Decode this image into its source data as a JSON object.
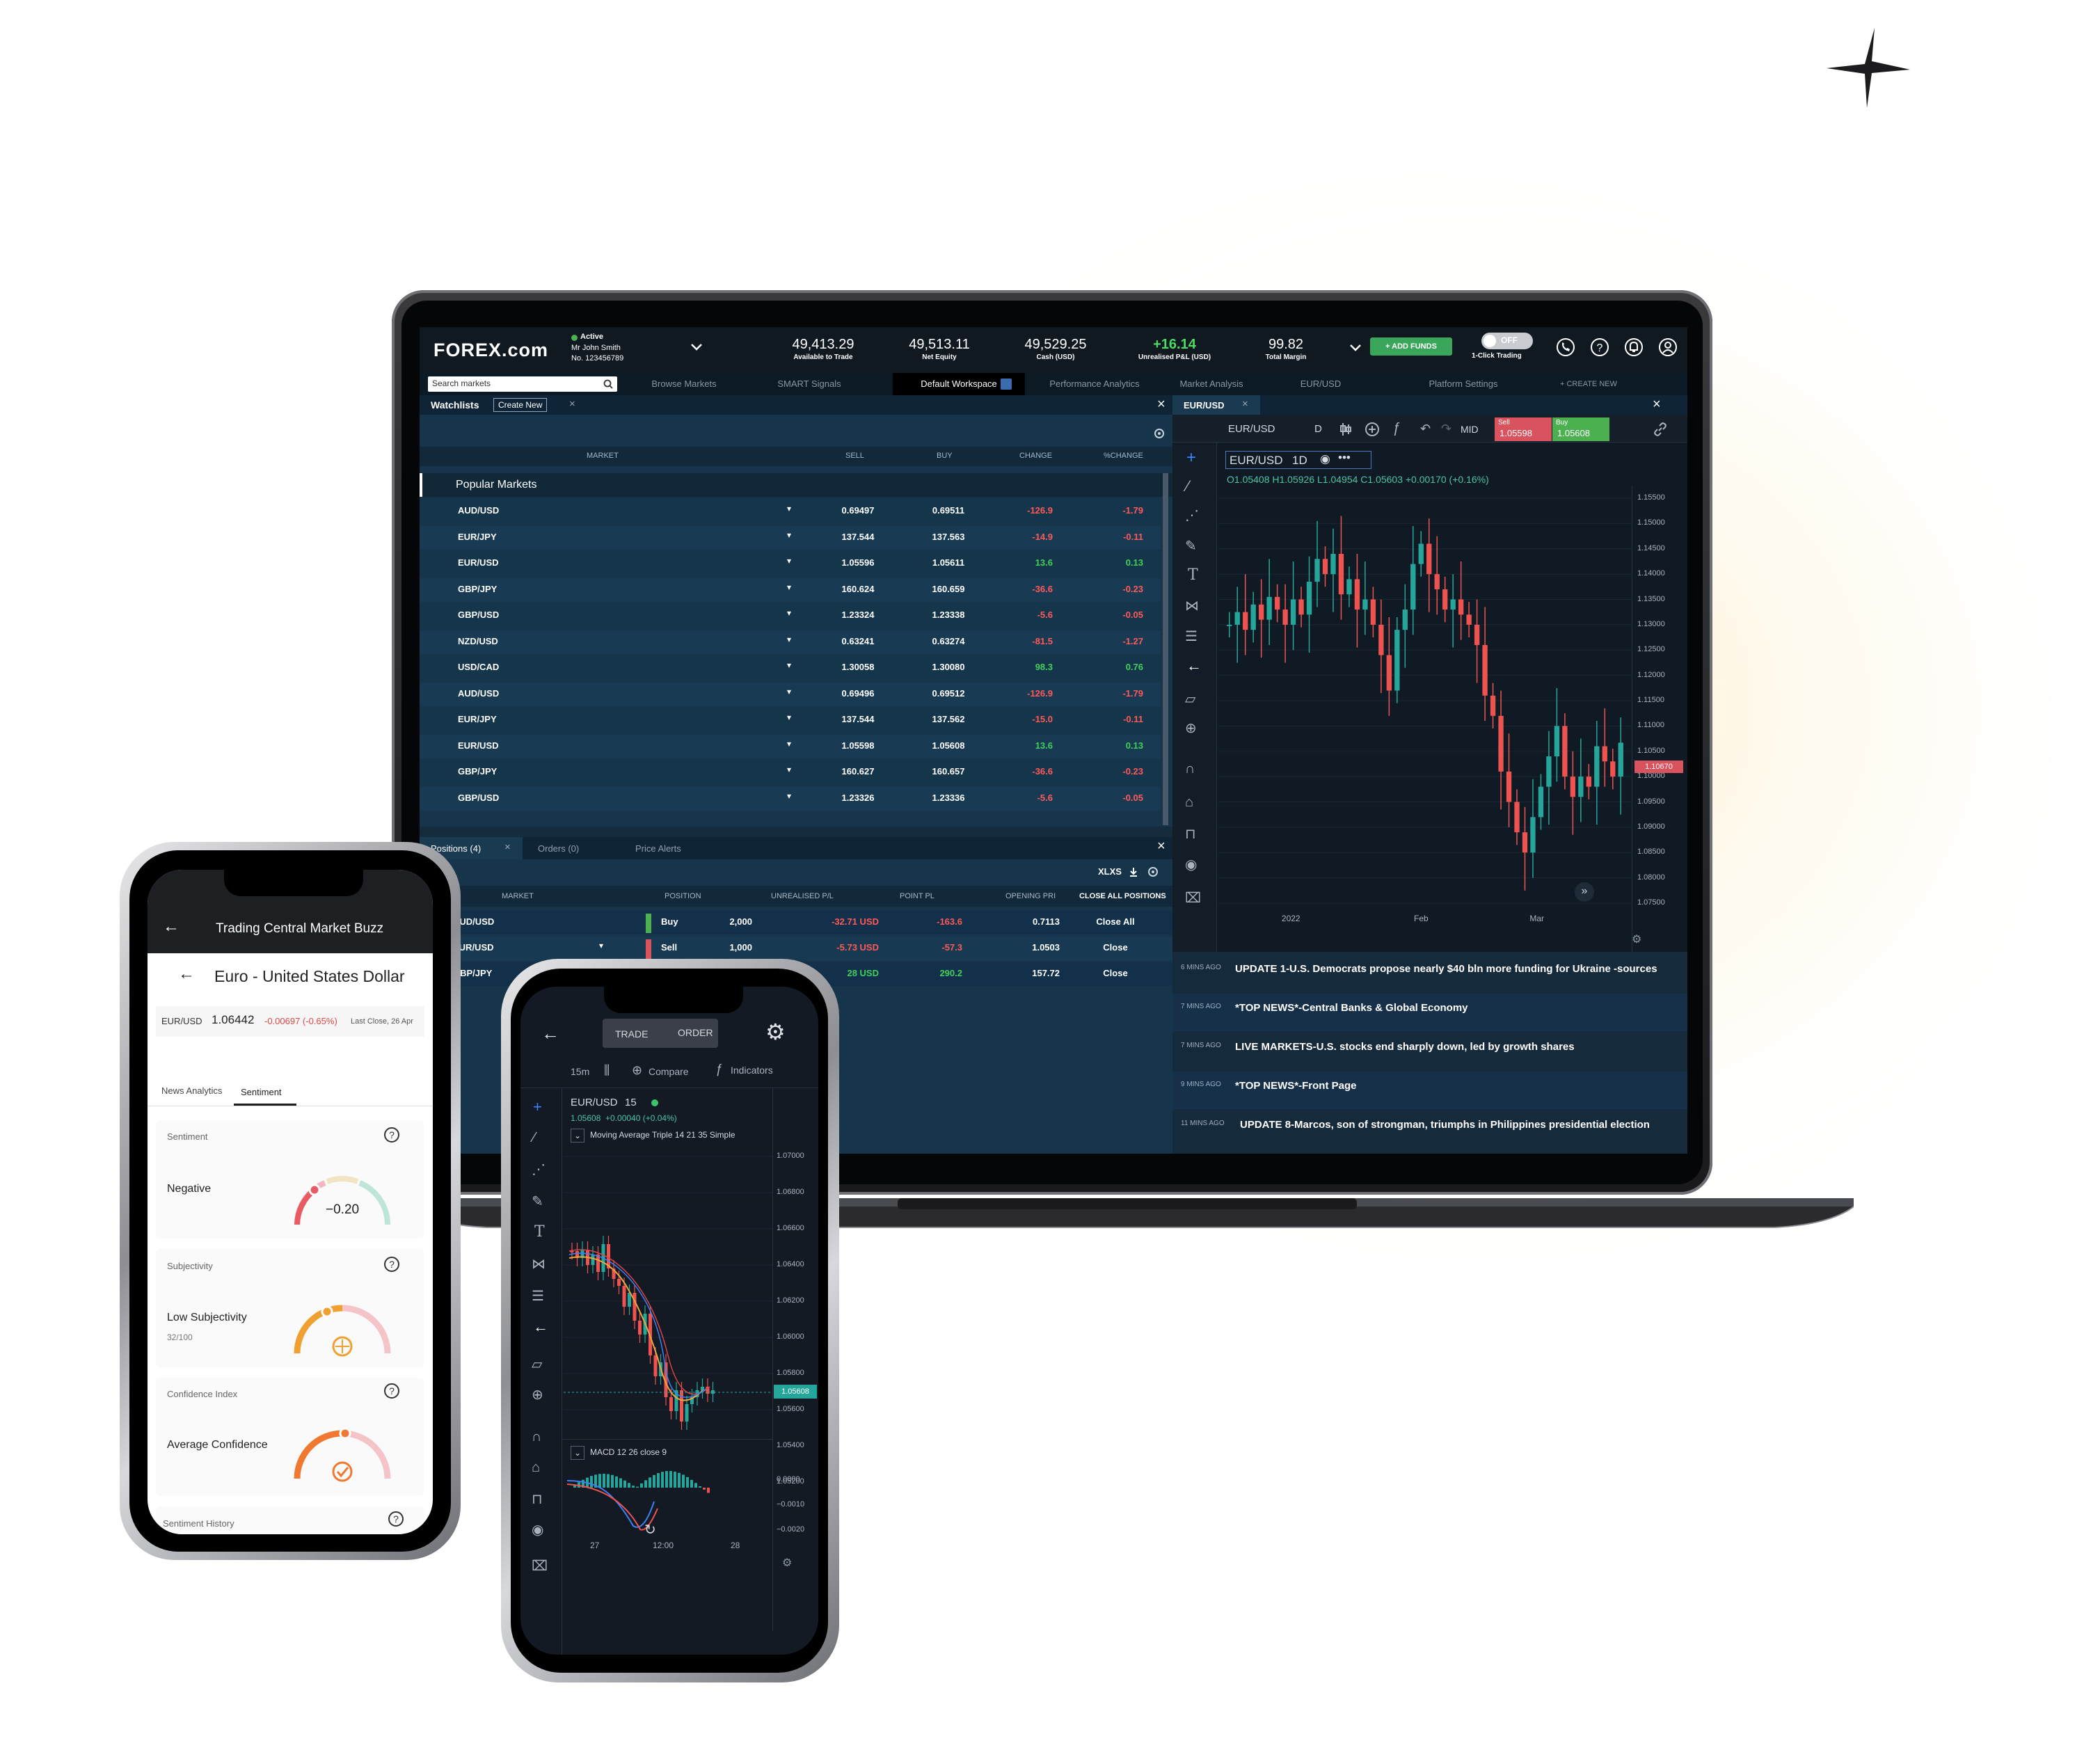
{
  "brand": "FOREX.com",
  "account": {
    "status": "Active",
    "name": "Mr John Smith",
    "number": "No. 123456789"
  },
  "stats": [
    {
      "value": "49,413.29",
      "label": "Available to Trade"
    },
    {
      "value": "49,513.11",
      "label": "Net Equity"
    },
    {
      "value": "49,529.25",
      "label": "Cash (USD)"
    },
    {
      "value": "+16.14",
      "label": "Unrealised P&L (USD)"
    },
    {
      "value": "99.82",
      "label": "Total Margin"
    }
  ],
  "add_funds": "+ ADD FUNDS",
  "one_click": {
    "state": "OFF",
    "label": "1-Click Trading"
  },
  "search_placeholder": "Search markets",
  "nav_tabs": [
    "Browse Markets",
    "SMART Signals",
    "Default Workspace",
    "Performance Analytics",
    "Market Analysis",
    "EUR/USD",
    "Platform Settings",
    "+ CREATE NEW"
  ],
  "watchlist": {
    "tab": "Watchlists",
    "create": "Create New",
    "columns": [
      "MARKET",
      "SELL",
      "BUY",
      "CHANGE",
      "%CHANGE"
    ],
    "group": "Popular Markets",
    "rows": [
      [
        "AUD/USD",
        "0.69497",
        "0.69511",
        "-126.9",
        "-1.79"
      ],
      [
        "EUR/JPY",
        "137.544",
        "137.563",
        "-14.9",
        "-0.11"
      ],
      [
        "EUR/USD",
        "1.05596",
        "1.05611",
        "13.6",
        "0.13"
      ],
      [
        "GBP/JPY",
        "160.624",
        "160.659",
        "-36.6",
        "-0.23"
      ],
      [
        "GBP/USD",
        "1.23324",
        "1.23338",
        "-5.6",
        "-0.05"
      ],
      [
        "NZD/USD",
        "0.63241",
        "0.63274",
        "-81.5",
        "-1.27"
      ],
      [
        "USD/CAD",
        "1.30058",
        "1.30080",
        "98.3",
        "0.76"
      ],
      [
        "AUD/USD",
        "0.69496",
        "0.69512",
        "-126.9",
        "-1.79"
      ],
      [
        "EUR/JPY",
        "137.544",
        "137.562",
        "-15.0",
        "-0.11"
      ],
      [
        "EUR/USD",
        "1.05598",
        "1.05608",
        "13.6",
        "0.13"
      ],
      [
        "GBP/JPY",
        "160.627",
        "160.657",
        "-36.6",
        "-0.23"
      ],
      [
        "GBP/USD",
        "1.23326",
        "1.23336",
        "-5.6",
        "-0.05"
      ]
    ]
  },
  "positions": {
    "tabs": [
      "Positions (4)",
      "Orders (0)",
      "Price Alerts"
    ],
    "export": "XLXS",
    "columns": [
      "MARKET",
      "POSITION",
      "UNREALISED P/L",
      "POINT PL",
      "OPENING PRI",
      "CLOSE ALL POSITIONS"
    ],
    "rows": [
      {
        "market": "AUD/USD",
        "side": "Buy",
        "qty": "2,000",
        "pl": "-32.71 USD",
        "pts": "-163.6",
        "open": "0.7113",
        "action": "Close All"
      },
      {
        "market": "EUR/USD",
        "side": "Sell",
        "qty": "1,000",
        "pl": "-5.73 USD",
        "pts": "-57.3",
        "open": "1.0503",
        "action": "Close"
      },
      {
        "market": "GBP/JPY",
        "side": "",
        "qty": "",
        "pl": "28 USD",
        "pts": "290.2",
        "open": "157.72",
        "action": "Close"
      }
    ]
  },
  "chart_panel": {
    "tab": "EUR/USD",
    "symbol": "EUR/USD",
    "interval": "D",
    "price_type": "MID",
    "sell_label": "Sell",
    "sell": "1.05598",
    "buy_label": "Buy",
    "buy": "1.05608",
    "legend_symbol": "EUR/USD",
    "legend_interval": "1D",
    "ohlc": "O1.05408 H1.05926 L1.04954 C1.05603 +0.00170 (+0.16%)",
    "last_price": "1.10670"
  },
  "chart_data": {
    "type": "line",
    "title": "EUR/USD 1D",
    "x": [
      "2022",
      "Feb",
      "Mar"
    ],
    "ylim": [
      1.075,
      1.155
    ],
    "yticks": [
      "1.15500",
      "1.15000",
      "1.14500",
      "1.14000",
      "1.13500",
      "1.13000",
      "1.12500",
      "1.12000",
      "1.11500",
      "1.11000",
      "1.10500",
      "1.10000",
      "1.09500",
      "1.09000",
      "1.08500",
      "1.08000",
      "1.07500"
    ],
    "series": [
      {
        "values": [
          1.13,
          1.1325,
          1.129,
          1.134,
          1.131,
          1.1355,
          1.133,
          1.13,
          1.135,
          1.132,
          1.1385,
          1.143,
          1.14,
          1.144,
          1.136,
          1.139,
          1.133,
          1.135,
          1.13,
          1.124,
          1.117,
          1.129,
          1.133,
          1.142,
          1.146,
          1.14,
          1.137,
          1.133,
          1.135,
          1.132,
          1.13,
          1.126,
          1.116,
          1.112,
          1.101,
          1.095,
          1.089,
          1.085,
          1.092,
          1.098,
          1.104,
          1.11,
          1.1,
          1.096,
          1.1,
          1.098,
          1.106,
          1.103,
          1.1,
          1.1067
        ]
      }
    ]
  },
  "news": [
    {
      "time": "6 MINS AGO",
      "text": "UPDATE 1-U.S. Democrats propose nearly $40 bln more funding for Ukraine -sources"
    },
    {
      "time": "7 MINS AGO",
      "text": "*TOP NEWS*-Central Banks & Global Economy"
    },
    {
      "time": "7 MINS AGO",
      "text": "LIVE MARKETS-U.S. stocks end sharply down, led by growth shares"
    },
    {
      "time": "9 MINS AGO",
      "text": "*TOP NEWS*-Front Page"
    },
    {
      "time": "11 MINS AGO",
      "text": "UPDATE 8-Marcos, son of strongman, triumphs in Philippines presidential election"
    }
  ],
  "phone_left": {
    "title": "Trading Central Market Buzz",
    "subtitle": "Euro - United States Dollar",
    "pair": "EUR/USD",
    "price": "1.06442",
    "change": "-0.00697 (-0.65%)",
    "close": "Last Close, 26 Apr",
    "tabs": [
      "News Analytics",
      "Sentiment"
    ],
    "cards": [
      {
        "title": "Sentiment",
        "label": "Negative",
        "value": "−0.20"
      },
      {
        "title": "Subjectivity",
        "label": "Low Subjectivity",
        "value": "32/100"
      },
      {
        "title": "Confidence Index",
        "label": "Average Confidence",
        "value": ""
      }
    ],
    "history": "Sentiment History"
  },
  "phone_right": {
    "tabs": [
      "TRADE",
      "ORDER"
    ],
    "interval": "15m",
    "compare": "Compare",
    "indicators": "Indicators",
    "symbol": "EUR/USD",
    "symbol_interval": "15",
    "price": "1.05608",
    "change": "+0.00040 (+0.04%)",
    "indicator": "Moving Average Triple 14 21 35 Simple",
    "macd": "MACD 12 26 close 9",
    "yticks": [
      "1.07000",
      "1.06800",
      "1.06600",
      "1.06400",
      "1.06200",
      "1.06000",
      "1.05800",
      "1.05600",
      "1.05400",
      "1.05200"
    ],
    "last": "1.05608",
    "macd_ticks": [
      "0.0000",
      "−0.0010",
      "−0.0020"
    ],
    "xticks": [
      "27",
      "12:00",
      "28"
    ]
  }
}
